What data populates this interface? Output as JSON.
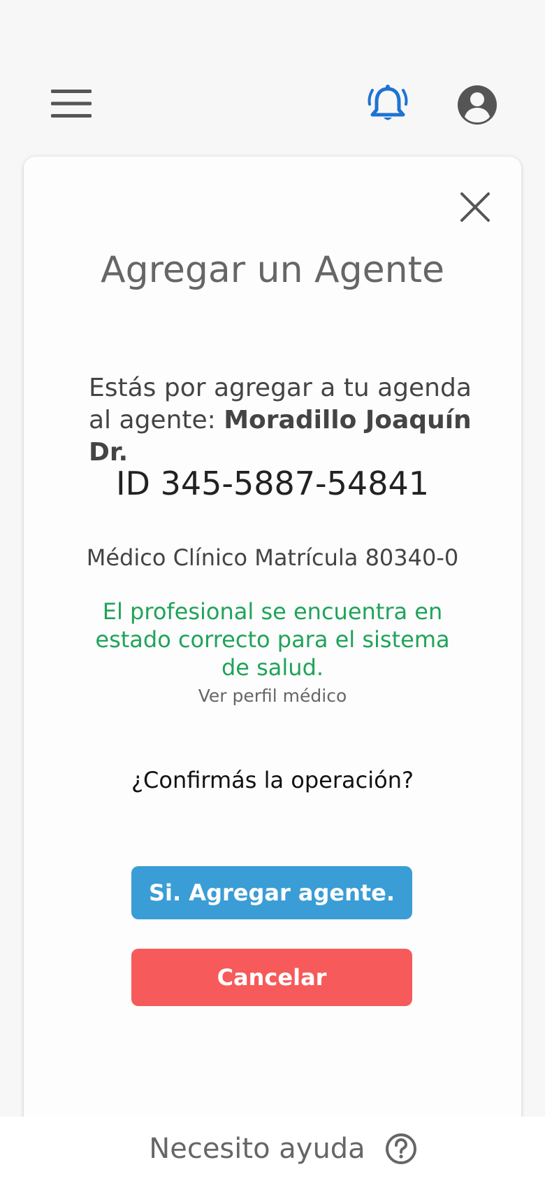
{
  "header": {
    "menu_icon": "hamburger-menu-icon",
    "notification_icon": "bell-ringing-icon",
    "account_icon": "account-circle-icon",
    "accent_color": "#1e73d2",
    "icon_color": "#555555"
  },
  "dialog": {
    "close_icon": "close-icon",
    "title": "Agregar un Agente",
    "intro_text": "Estás por agregar a tu agenda al agente: ",
    "agent_name": "Moradillo Joaquín Dr.",
    "agent_id": "ID 345-5887-54841",
    "specialty": "Médico Clínico Matrícula 80340-0",
    "status_message": "El profesional se encuentra en estado correcto para el sistema de salud.",
    "status_color": "#20a35a",
    "profile_link": "Ver perfil médico",
    "confirm_question": "¿Confirmás la operación?",
    "confirm_button": "Si. Agregar agente.",
    "confirm_button_color": "#3a9dd6",
    "cancel_button": "Cancelar",
    "cancel_button_color": "#f65a5a"
  },
  "footer": {
    "help_text": "Necesito ayuda",
    "help_icon": "question-circle-icon"
  }
}
